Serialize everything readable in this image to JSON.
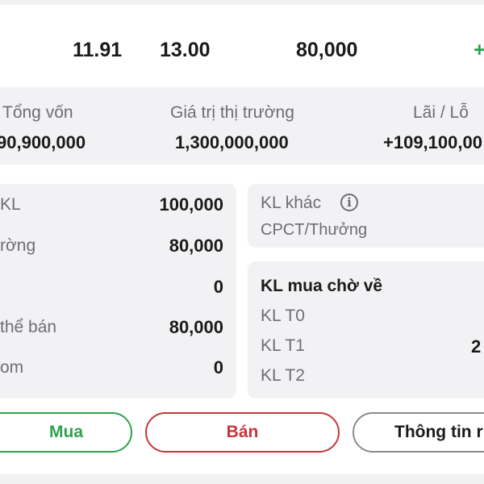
{
  "top_row": {
    "price_avg": "11.91",
    "price_market": "13.00",
    "quantity": "80,000",
    "change_sign": "+"
  },
  "summary": {
    "cost_label": "Tổng vốn",
    "cost_value": "90,900,000",
    "market_value_label": "Giá trị thị trường",
    "market_value": "1,300,000,000",
    "pnl_label": "Lãi / Lỗ",
    "pnl_value": "+109,100,00"
  },
  "holdings": [
    {
      "label": "KL",
      "value": "100,000"
    },
    {
      "label": "rờng",
      "value": "80,000"
    },
    {
      "label": "",
      "value": "0"
    },
    {
      "label": "thể bán",
      "value": "80,000"
    },
    {
      "label": "om",
      "value": "0"
    }
  ],
  "other_card": {
    "other_label": "KL khác",
    "bonus_label": "CPCT/Thưởng"
  },
  "pending_card": {
    "title": "KL mua chờ về",
    "t0_label": "KL T0",
    "t1_label": "KL T1",
    "t1_value": "2",
    "t2_label": "KL T2"
  },
  "actions": {
    "buy": "Mua",
    "sell": "Bán",
    "info": "Thông tin r"
  },
  "colors": {
    "green": "#2ea24f",
    "red": "#c7353a",
    "panel_bg": "#f2f2f4"
  }
}
